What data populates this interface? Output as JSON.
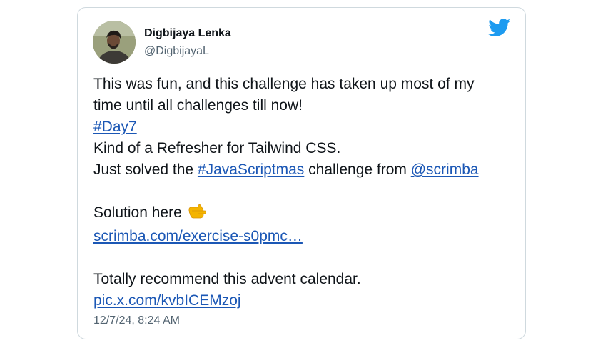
{
  "author": {
    "name": "Digbijaya Lenka",
    "handle": "@DigbijayaL",
    "avatar_icon": "user-avatar-photo"
  },
  "brand": {
    "icon": "twitter-bird-icon",
    "color": "#1d9bf0"
  },
  "tweet": {
    "line1": "This was fun, and this challenge has taken up most of my",
    "line2": "time until all challenges till now!",
    "hashtag_day7": "#Day7",
    "line4": "Kind of a Refresher for Tailwind CSS.",
    "line5_prefix": "Just solved the ",
    "hashtag_javascriptmas": "#JavaScriptmas",
    "line5_middle": " challenge from ",
    "mention_scrimba": "@scrimba",
    "solution_label": "Solution here ",
    "solution_emoji": "pointing-right-hand-icon",
    "solution_link": "scrimba.com/exercise-s0pmc…",
    "recommend_text": "Totally recommend this advent calendar.",
    "pic_link": "pic.x.com/kvbICEMzoj"
  },
  "timestamp": "12/7/24, 8:24 AM",
  "colors": {
    "link": "#1b57b5",
    "text": "#0f1419",
    "secondary": "#536471",
    "border": "#cfd9de"
  }
}
